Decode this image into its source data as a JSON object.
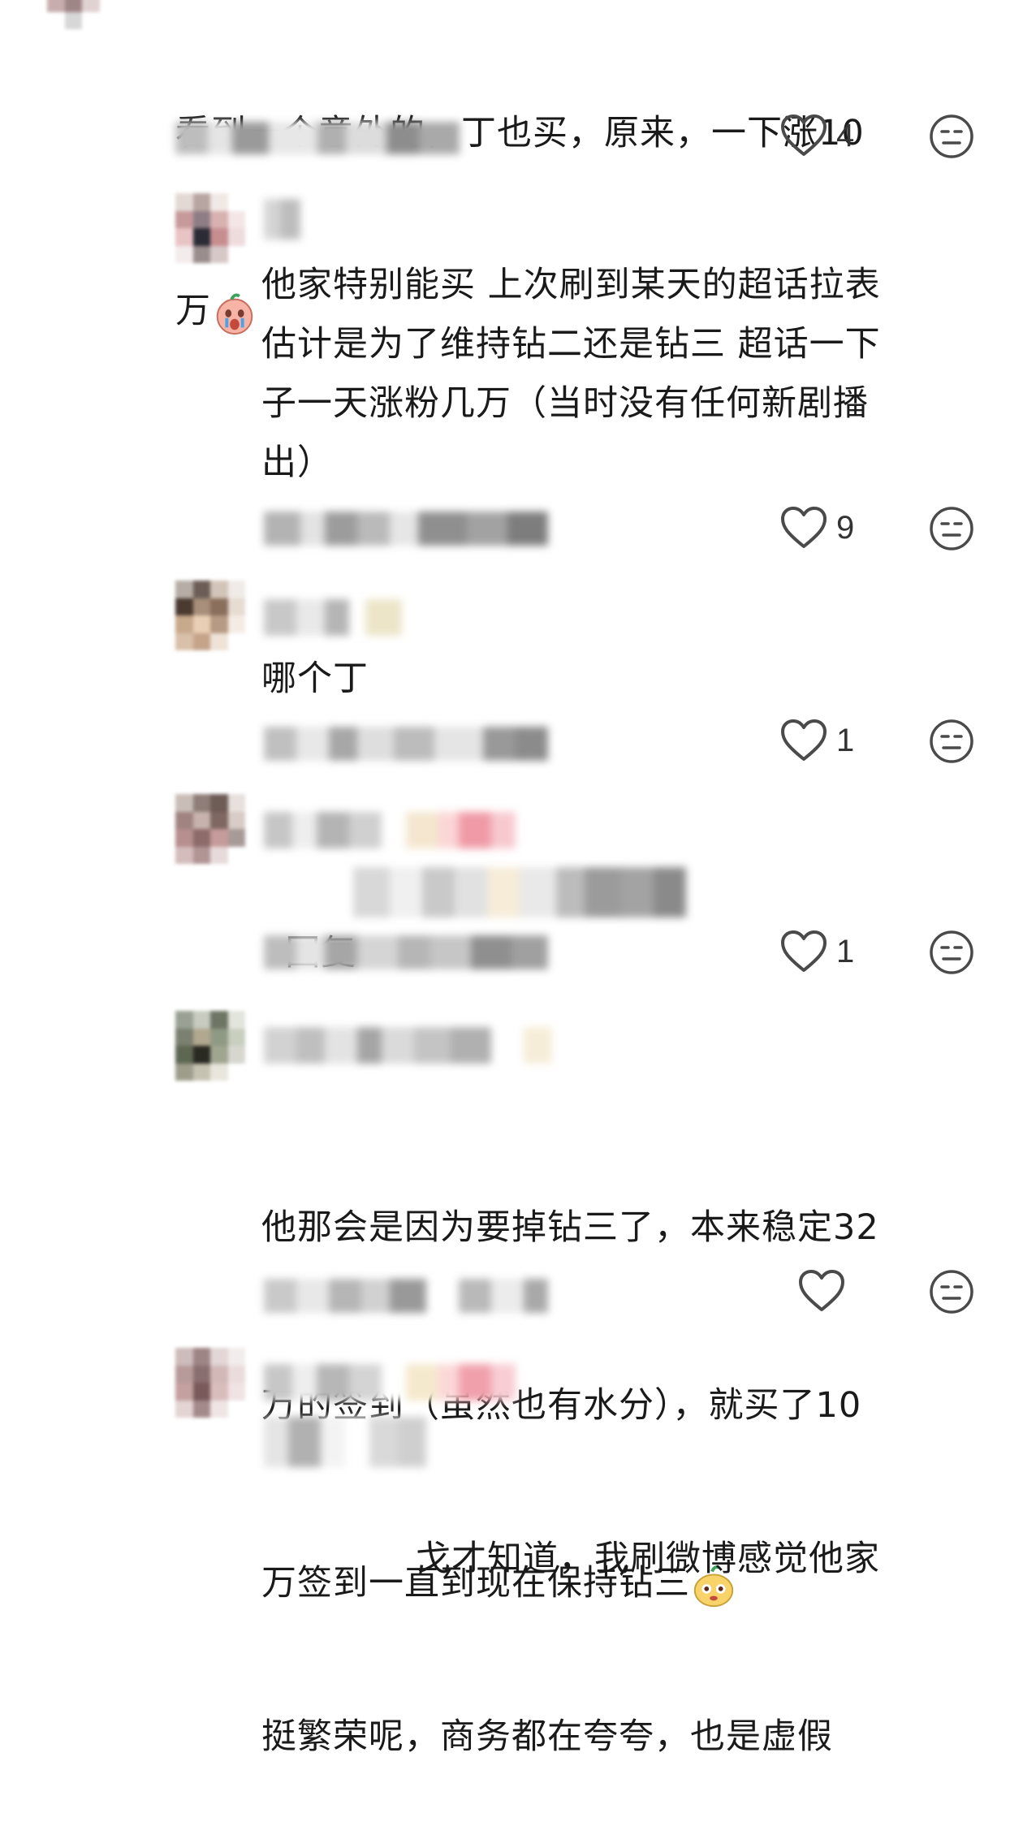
{
  "comments": [
    {
      "text_line1": "看到一个意外的，丁也买，原来，一下涨10",
      "text_line2": "万",
      "emoji_icon": "crying-peach-icon",
      "like_count": "4"
    },
    {
      "text": "他家特别能买 上次刷到某天的超话拉表\n估计是为了维持钻二还是钻三 超话一下\n子一天涨粉几万（当时没有任何新剧播\n出）",
      "like_count": "9"
    },
    {
      "text": "哪个丁",
      "like_count": "1"
    },
    {
      "reply_prefix": "回复",
      "like_count": "1"
    },
    {
      "text_line1": "他那会是因为要掉钻三了，本来稳定32",
      "text_line2": "万的签到（虽然也有水分），就买了10",
      "text_line3": "万签到一直到现在保持钻三",
      "emoji_icon": "yellow-mascot-icon",
      "like_count": ""
    },
    {
      "text_line1": "戈才知道，我刷微博感觉他家",
      "text_line2": "挺繁荣呢，商务都在夸夸，也是虚假"
    }
  ],
  "icons": {
    "like": "heart-outline-icon",
    "dislike": "meh-face-icon"
  }
}
